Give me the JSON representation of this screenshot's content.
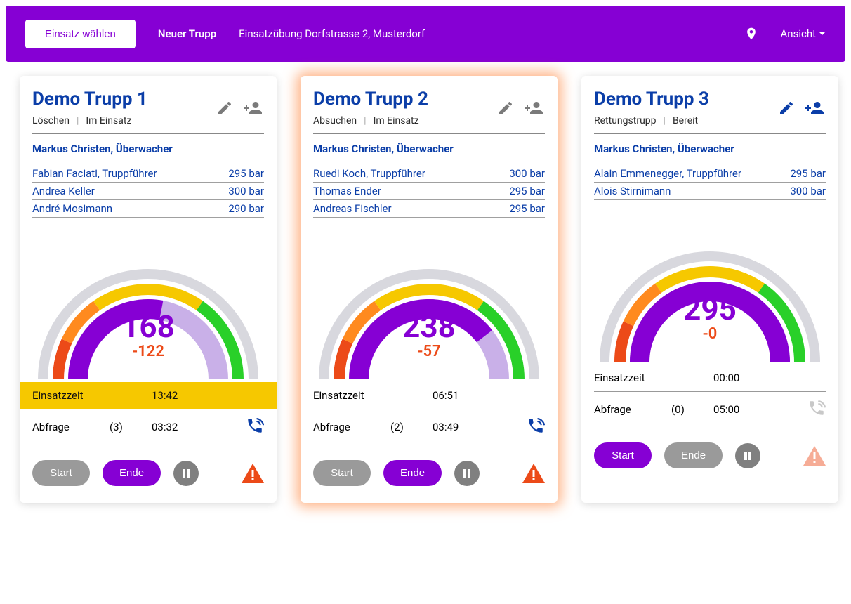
{
  "header": {
    "select_mission": "Einsatz wählen",
    "new_team": "Neuer Trupp",
    "mission_title": "Einsatzübung Dorfstrasse 2, Musterdorf",
    "view_label": "Ansicht"
  },
  "labels": {
    "einsatzzeit": "Einsatzzeit",
    "abfrage": "Abfrage",
    "start": "Start",
    "ende": "Ende"
  },
  "colors": {
    "brand": "#8600d4",
    "blue": "#0b3ea8",
    "orange": "#ec4a18",
    "yellow": "#f6c800",
    "green": "#29d029"
  },
  "cards": [
    {
      "title": "Demo Trupp 1",
      "task": "Löschen",
      "status": "Im Einsatz",
      "supervisor": "Markus Christen, Überwacher",
      "members": [
        {
          "name": "Fabian Faciati, Truppführer",
          "pressure": "295 bar"
        },
        {
          "name": "Andrea Keller",
          "pressure": "300 bar"
        },
        {
          "name": "André Mosimann",
          "pressure": "290 bar"
        }
      ],
      "gauge": {
        "value": "168",
        "delta": "-122",
        "fill_pct": 56
      },
      "einsatzzeit": "13:42",
      "einsatzzeit_warn": true,
      "abfrage_count": "(3)",
      "abfrage_time": "03:32",
      "phone_enabled": true,
      "start_enabled": false,
      "ende_enabled": true,
      "warn_enabled": true,
      "highlight": false
    },
    {
      "title": "Demo Trupp 2",
      "task": "Absuchen",
      "status": "Im Einsatz",
      "supervisor": "Markus Christen, Überwacher",
      "members": [
        {
          "name": "Ruedi Koch, Truppführer",
          "pressure": "300 bar"
        },
        {
          "name": "Thomas Ender",
          "pressure": "295 bar"
        },
        {
          "name": "Andreas Fischler",
          "pressure": "295 bar"
        }
      ],
      "gauge": {
        "value": "238",
        "delta": "-57",
        "fill_pct": 79
      },
      "einsatzzeit": "06:51",
      "einsatzzeit_warn": false,
      "abfrage_count": "(2)",
      "abfrage_time": "03:49",
      "phone_enabled": true,
      "start_enabled": false,
      "ende_enabled": true,
      "warn_enabled": true,
      "highlight": true
    },
    {
      "title": "Demo Trupp 3",
      "task": "Rettungstrupp",
      "status": "Bereit",
      "supervisor": "Markus Christen, Überwacher",
      "members": [
        {
          "name": "Alain Emmenegger, Truppführer",
          "pressure": "295 bar"
        },
        {
          "name": "Alois Stirnimann",
          "pressure": "300 bar"
        }
      ],
      "gauge": {
        "value": "295",
        "delta": "-0",
        "fill_pct": 100
      },
      "einsatzzeit": "00:00",
      "einsatzzeit_warn": false,
      "abfrage_count": "(0)",
      "abfrage_time": "05:00",
      "phone_enabled": false,
      "start_enabled": true,
      "ende_enabled": false,
      "warn_enabled": false,
      "highlight": false
    }
  ]
}
